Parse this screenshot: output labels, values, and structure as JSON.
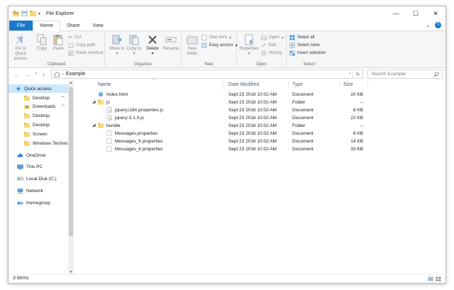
{
  "window": {
    "title": "File Explorer"
  },
  "title_controls": {
    "minimize": "—",
    "maximize": "☐",
    "close": "✕"
  },
  "tabs": [
    {
      "label": "File"
    },
    {
      "label": "Home"
    },
    {
      "label": "Share"
    },
    {
      "label": "View"
    }
  ],
  "tab_right": {
    "expand": "⌄",
    "help": "?"
  },
  "ribbon": {
    "clipboard": {
      "label": "Clipboard",
      "pin": "Pin to Quick access",
      "copy": "Copy",
      "paste": "Paste",
      "cut": "Cut",
      "copy_path": "Copy path",
      "paste_shortcut": "Paste shortcut"
    },
    "organize": {
      "label": "Organize",
      "move_to": "Move to",
      "copy_to": "Copy to",
      "delete": "Delete",
      "rename": "Rename"
    },
    "new": {
      "label": "New",
      "new_folder": "New folder",
      "new_item": "New item",
      "easy_access": "Easy access"
    },
    "open": {
      "label": "Open",
      "properties": "Properties",
      "open": "Open",
      "edit": "Edit",
      "history": "History"
    },
    "select": {
      "label": "Select",
      "select_all": "Select all",
      "select_none": "Select none",
      "invert": "Invert selection"
    }
  },
  "address": {
    "back": "←",
    "forward": "→",
    "up": "↑",
    "path": "Example",
    "refresh": "↻",
    "dropdown": "⌄",
    "search_placeholder": "Search Example"
  },
  "nav": {
    "items": [
      {
        "label": "Quick access",
        "icon": "star-icon"
      },
      {
        "label": "Desktop",
        "icon": "folder-icon",
        "pinned": "📌"
      },
      {
        "label": "Downloads",
        "icon": "download-icon",
        "pinned": "📌"
      },
      {
        "label": "Desktop",
        "icon": "folder-icon"
      },
      {
        "label": "Desktop",
        "icon": "folder-icon"
      },
      {
        "label": "Screen",
        "icon": "folder-icon"
      },
      {
        "label": "Windows Technic",
        "icon": "folder-icon"
      },
      {
        "label": "OneDrive",
        "icon": "cloud-icon"
      },
      {
        "label": "This PC",
        "icon": "computer-icon"
      },
      {
        "label": "Local Disk (C:)",
        "icon": "drive-icon"
      },
      {
        "label": "Network",
        "icon": "network-icon"
      },
      {
        "label": "Homegroup",
        "icon": "homegroup-icon"
      }
    ],
    "scroll_up": "▲",
    "scroll_down": "▼"
  },
  "list": {
    "columns": {
      "name": "Name",
      "date": "Date Modified",
      "type": "Type",
      "size": "Size"
    },
    "sort_indicator": "^",
    "rows": [
      {
        "name": "Index.html",
        "date": "Sept 23 2016 10:02 AM",
        "type": "Document",
        "size": "20 KB",
        "icon": "html-file-icon"
      },
      {
        "name": "js",
        "date": "Sept 23 2016 10:02 AM",
        "type": "Folder",
        "size": "--",
        "icon": "folder-icon",
        "twisty": "◢"
      },
      {
        "name": "jquery.i18n.properties.js",
        "date": "Sept 23 2016 10:02 AM",
        "type": "Document",
        "size": "8 KB",
        "icon": "js-file-icon"
      },
      {
        "name": "jquery-3.1.0.js",
        "date": "Sept 23 2016 10:02 AM",
        "type": "Document",
        "size": "22 KB",
        "icon": "js-file-icon"
      },
      {
        "name": "bundle",
        "date": "Sept 23 2016 10:02 AM",
        "type": "Folder",
        "size": "--",
        "icon": "folder-icon",
        "twisty": "◢"
      },
      {
        "name": "Messages.properties",
        "date": "Sept 23 2016 10:02 AM",
        "type": "Document",
        "size": "6 KB",
        "icon": "file-icon"
      },
      {
        "name": "Messages_fr.properties",
        "date": "Sept 23 2016 10:02 AM",
        "type": "Document",
        "size": "14 KB",
        "icon": "file-icon"
      },
      {
        "name": "Messages_tr.properties",
        "date": "Sept 23 2016 10:02 AM",
        "type": "Document",
        "size": "33 KB",
        "icon": "file-icon"
      }
    ]
  },
  "status": {
    "items": "3 items"
  },
  "colors": {
    "accent": "#1979ca",
    "folder": "#f8d775",
    "selection": "#cce8ff"
  }
}
